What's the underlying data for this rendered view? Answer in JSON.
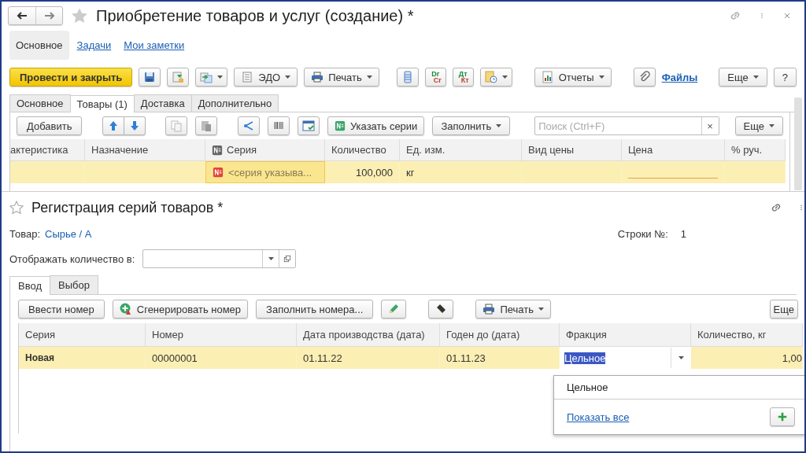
{
  "window": {
    "title": "Приобретение товаров и услуг (создание) *"
  },
  "sections": [
    {
      "label": "Основное",
      "selected": true
    },
    {
      "label": "Задачи",
      "selected": false
    },
    {
      "label": "Мои заметки",
      "selected": false
    }
  ],
  "main_toolbar": {
    "post_close": "Провести и закрыть",
    "edo": "ЭДО",
    "print": "Печать",
    "dr": "Dr",
    "cr": "Cr",
    "dt": "Дт",
    "kt": "Кт",
    "reports": "Отчеты",
    "files": "Файлы",
    "more": "Еще",
    "help": "?"
  },
  "tabs": [
    {
      "label": "Основное",
      "selected": false
    },
    {
      "label": "Товары (1)",
      "selected": true
    },
    {
      "label": "Доставка",
      "selected": false
    },
    {
      "label": "Дополнительно",
      "selected": false
    }
  ],
  "goods_toolbar": {
    "add": "Добавить",
    "set_series": "Указать серии",
    "fill": "Заполнить",
    "search": {
      "placeholder": "Поиск (Ctrl+F)"
    },
    "clear": "×",
    "more": "Еще"
  },
  "goods_table": {
    "columns": [
      "актеристика",
      "Назначение",
      "Серия",
      "Количество",
      "Ед. изм.",
      "Вид цены",
      "Цена",
      "% руч."
    ],
    "rows": [
      {
        "selected": true,
        "cells": [
          "",
          "",
          "<серия указыва...",
          "100,000",
          "кг",
          "",
          "",
          ""
        ]
      }
    ]
  },
  "dialog": {
    "title": "Регистрация серий товаров *",
    "product_label": "Товар:",
    "product": "Сырье / А",
    "rows_label": "Строки №:",
    "rows_value": "1",
    "unit_label": "Отображать количество в:",
    "tabs": [
      {
        "label": "Ввод",
        "selected": true
      },
      {
        "label": "Выбор",
        "selected": false
      }
    ],
    "toolbar": {
      "enter": "Ввести номер",
      "generate": "Сгенерировать номер",
      "fill": "Заполнить номера...",
      "print": "Печать",
      "more": "Еще"
    },
    "table": {
      "columns": [
        "Серия",
        "Номер",
        "Дата производства (дата)",
        "Годен до (дата)",
        "Фракция",
        "Количество, кг"
      ],
      "rows": [
        {
          "selected": true,
          "cells": [
            "Новая",
            "00000001",
            "01.11.22",
            "01.11.23",
            "Цельное",
            "1,00"
          ]
        }
      ]
    },
    "dropdown": {
      "options": [
        "Цельное"
      ],
      "show_all": "Показать все"
    }
  }
}
